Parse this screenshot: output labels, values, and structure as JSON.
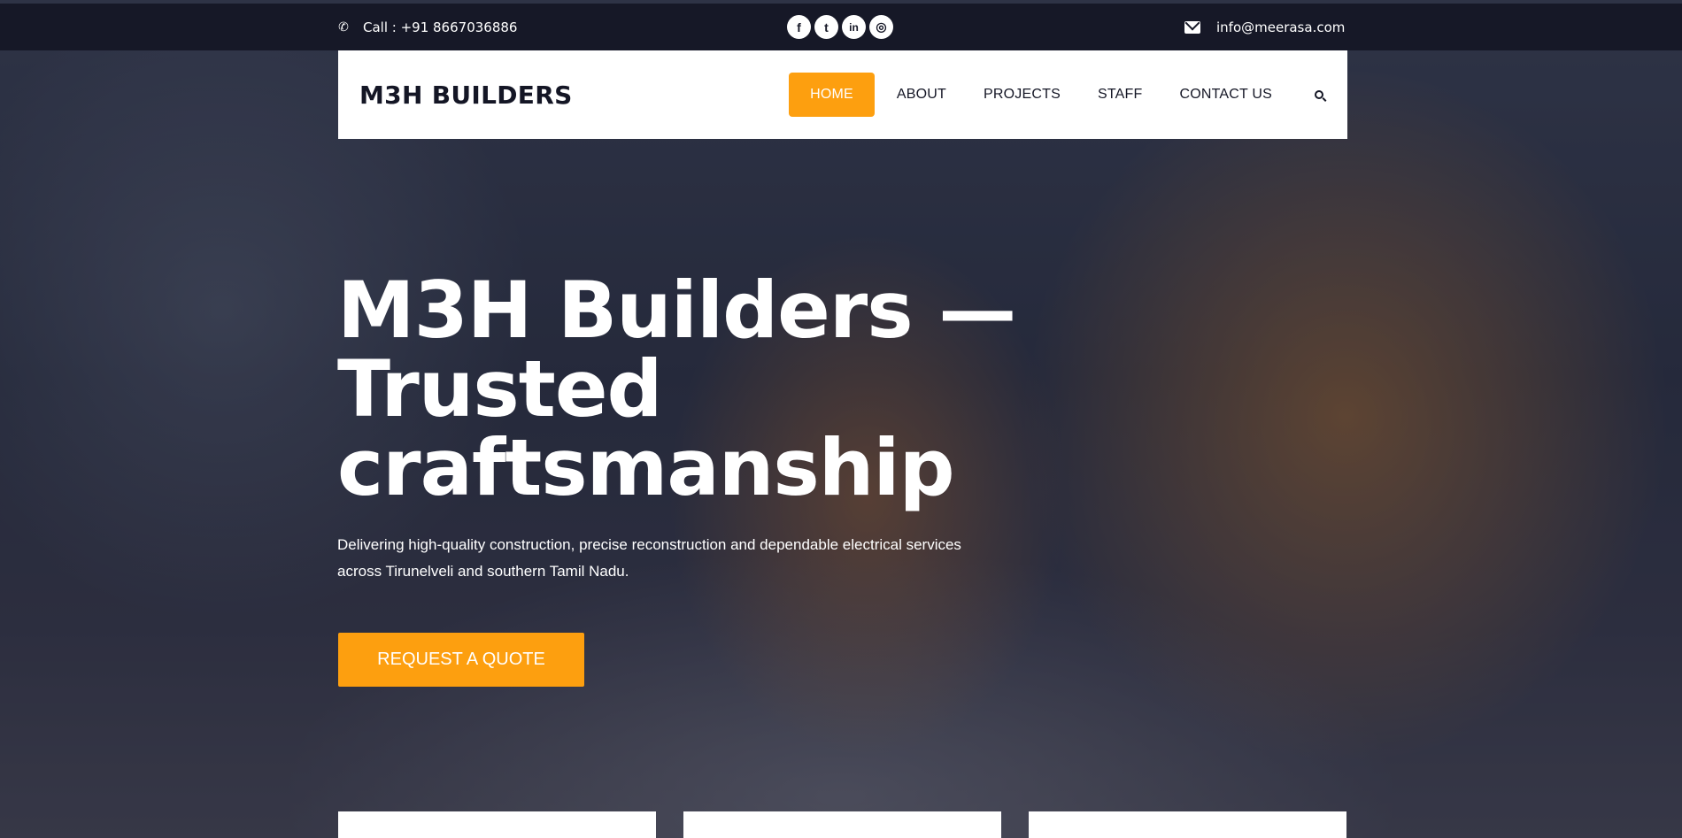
{
  "topbar": {
    "phone": "Call : +91 8667036886",
    "phone_icon": "phone-icon",
    "email": "info@meerasa.com",
    "email_icon": "envelope-icon",
    "social": [
      {
        "icon": "facebook-icon",
        "glyph": "f"
      },
      {
        "icon": "twitter-icon",
        "glyph": "t"
      },
      {
        "icon": "linkedin-icon",
        "glyph": "in"
      },
      {
        "icon": "instagram-icon",
        "glyph": "◎"
      }
    ]
  },
  "nav": {
    "brand": "M3H BUILDERS",
    "items": [
      {
        "label": "HOME",
        "active": true
      },
      {
        "label": "ABOUT",
        "active": false
      },
      {
        "label": "PROJECTS",
        "active": false
      },
      {
        "label": "STAFF",
        "active": false
      },
      {
        "label": "CONTACT US",
        "active": false
      }
    ],
    "search_icon": "search-icon"
  },
  "hero": {
    "title_line1": "M3H Builders —",
    "title_line2": "Trusted",
    "title_line3": "craftsmanship",
    "subtitle_line1": "Delivering high-quality construction, precise reconstruction and dependable electrical services",
    "subtitle_line2": "across Tirunelveli and southern Tamil Nadu.",
    "cta": "REQUEST A QUOTE"
  },
  "colors": {
    "accent": "#fd9f0f",
    "topbar": "#161827",
    "top_line": "#4c35c9"
  }
}
